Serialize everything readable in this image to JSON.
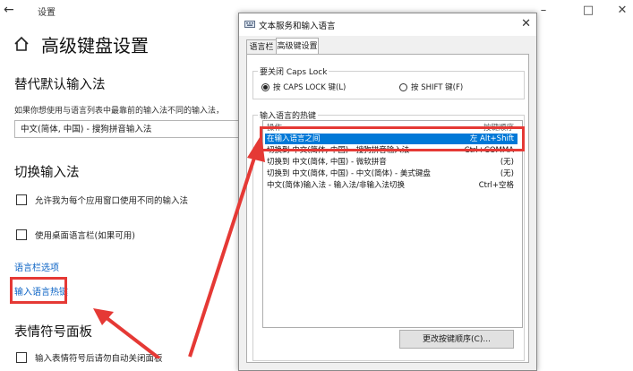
{
  "settings": {
    "window_title": "设置",
    "page_title": "高级键盘设置",
    "override_section": {
      "heading": "替代默认输入法",
      "description": "如果你想使用与语言列表中最靠前的输入法不同的输入法，",
      "dropdown_value": "中文(简体, 中国) - 搜狗拼音输入法"
    },
    "switch_section": {
      "heading": "切换输入法",
      "checkbox1": "允许我为每个应用窗口使用不同的输入法",
      "checkbox2": "使用桌面语言栏(如果可用)",
      "link_language_bar": "语言栏选项",
      "link_hotkeys": "输入语言热键"
    },
    "emoji_section": {
      "heading": "表情符号面板",
      "checkbox_partial": "输入表情符号后请勿自动关闭面板"
    }
  },
  "dialog": {
    "title": "文本服务和输入语言",
    "tabs": [
      "语言栏",
      "高级键设置"
    ],
    "active_tab": 1,
    "caps_group": {
      "label": "要关闭 Caps Lock",
      "option1": "按 CAPS LOCK 键(L)",
      "option2": "按 SHIFT 键(F)",
      "selected": 0
    },
    "hotkeys_group": {
      "label": "输入语言的热键",
      "col_action": "操作",
      "col_keys": "按键顺序",
      "rows": [
        {
          "action": "在输入语言之间",
          "keys": "左 Alt+Shift",
          "selected": true
        },
        {
          "action": "切换到 中文(简体, 中国) - 搜狗拼音输入法",
          "keys": "Ctrl+COMMA",
          "selected": false
        },
        {
          "action": "切换到 中文(简体, 中国) - 微软拼音",
          "keys": "(无)",
          "selected": false
        },
        {
          "action": "切换到 中文(简体, 中国) - 中文(简体) - 美式键盘",
          "keys": "(无)",
          "selected": false
        },
        {
          "action": "中文(简体)输入法 - 输入法/非输入法切换",
          "keys": "Ctrl+空格",
          "selected": false
        }
      ]
    },
    "change_button": "更改按键顺序(C)..."
  },
  "colors": {
    "accent": "#0078d7",
    "link": "#0b63c5",
    "annotation": "#e53935"
  }
}
